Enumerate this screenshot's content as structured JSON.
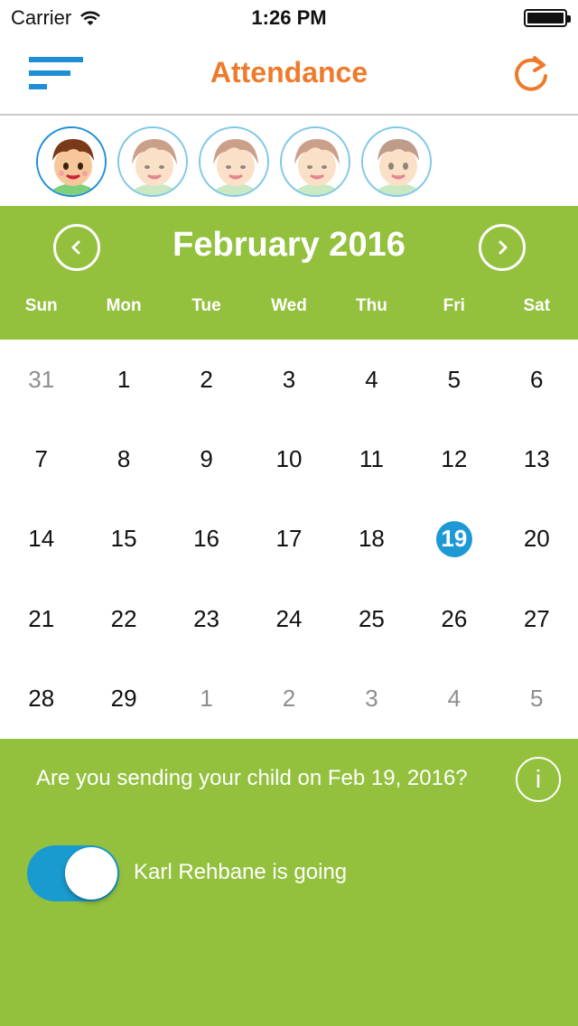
{
  "status_bar": {
    "carrier": "Carrier",
    "time": "1:26 PM"
  },
  "nav": {
    "title": "Attendance",
    "menu_icon": "menu-lines-icon",
    "refresh_icon": "refresh-icon"
  },
  "avatars": [
    {
      "name": "child-avatar-1",
      "selected": true
    },
    {
      "name": "child-avatar-2",
      "selected": false
    },
    {
      "name": "child-avatar-3",
      "selected": false
    },
    {
      "name": "child-avatar-4",
      "selected": false
    },
    {
      "name": "child-avatar-5",
      "selected": false
    }
  ],
  "calendar": {
    "month_title": "February 2016",
    "weekdays": [
      "Sun",
      "Mon",
      "Tue",
      "Wed",
      "Thu",
      "Fri",
      "Sat"
    ],
    "days": [
      {
        "label": "31",
        "other": true
      },
      {
        "label": "1"
      },
      {
        "label": "2"
      },
      {
        "label": "3"
      },
      {
        "label": "4"
      },
      {
        "label": "5"
      },
      {
        "label": "6"
      },
      {
        "label": "7"
      },
      {
        "label": "8"
      },
      {
        "label": "9"
      },
      {
        "label": "10"
      },
      {
        "label": "11"
      },
      {
        "label": "12"
      },
      {
        "label": "13"
      },
      {
        "label": "14"
      },
      {
        "label": "15"
      },
      {
        "label": "16"
      },
      {
        "label": "17"
      },
      {
        "label": "18"
      },
      {
        "label": "19",
        "selected": true
      },
      {
        "label": "20"
      },
      {
        "label": "21"
      },
      {
        "label": "22"
      },
      {
        "label": "23"
      },
      {
        "label": "24"
      },
      {
        "label": "25"
      },
      {
        "label": "26"
      },
      {
        "label": "27"
      },
      {
        "label": "28"
      },
      {
        "label": "29"
      },
      {
        "label": "1",
        "other": true
      },
      {
        "label": "2",
        "other": true
      },
      {
        "label": "3",
        "other": true
      },
      {
        "label": "4",
        "other": true
      },
      {
        "label": "5",
        "other": true
      }
    ]
  },
  "attendance": {
    "question": "Are you sending your child on Feb 19, 2016?",
    "info_label": "i",
    "toggle_on": true,
    "toggle_label": "Karl Rehbane is going"
  },
  "colors": {
    "accent_orange": "#ee7b2c",
    "panel_green": "#93c13e",
    "selected_blue": "#1d9ad6"
  }
}
